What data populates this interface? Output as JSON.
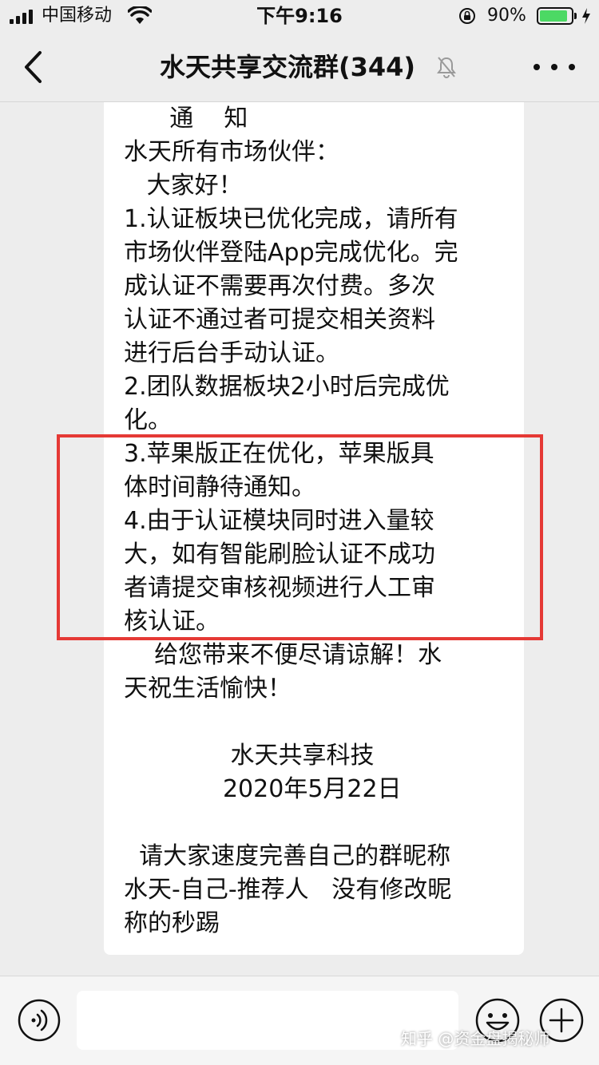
{
  "status_bar": {
    "carrier": "中国移动",
    "time": "下午9:16",
    "battery_text": "90%",
    "battery_level": 0.9,
    "battery_color": "#4cd964"
  },
  "nav": {
    "title": "水天共享交流群(344)",
    "back_icon": "chevron-left-icon",
    "mute_icon": "bell-slash-icon",
    "more_icon": "more-dots-icon"
  },
  "message": {
    "lines": [
      "      通    知",
      "水天所有市场伙伴：",
      "   大家好！",
      "1.认证板块已优化完成，请所有",
      "市场伙伴登陆App完成优化。完",
      "成认证不需要再次付费。多次",
      "认证不通过者可提交相关资料",
      "进行后台手动认证。",
      "2.团队数据板块2小时后完成优",
      "化。",
      "3.苹果版正在优化，苹果版具",
      "体时间静待通知。",
      "4.由于认证模块同时进入量较",
      "大，如有智能刷脸认证不成功",
      "者请提交审核视频进行人工审",
      "核认证。",
      "    给您带来不便尽请谅解！水",
      "天祝生活愉快！",
      "",
      "              水天共享科技",
      "             2020年5月22日",
      "",
      "  请大家速度完善自己的群昵称",
      "水天-自己-推荐人   没有修改昵",
      "称的秒踢"
    ],
    "highlight_color": "#e53935"
  },
  "input_bar": {
    "voice_icon": "voice-icon",
    "emoji_icon": "emoji-icon",
    "plus_icon": "plus-icon"
  },
  "watermark": "知乎 @资金盘揭秘师"
}
